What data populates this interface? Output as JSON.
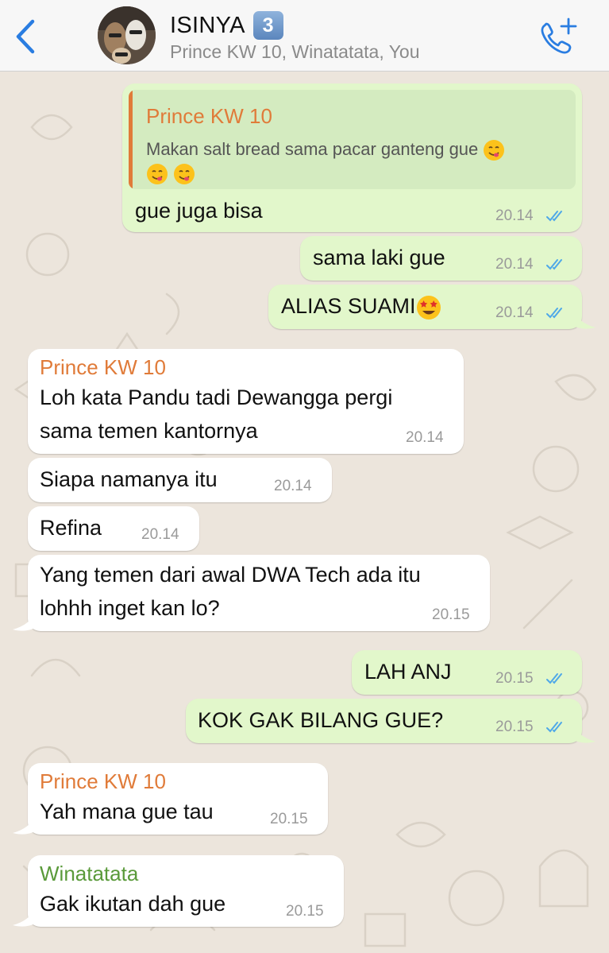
{
  "header": {
    "title": "ISINYA",
    "badge": "3",
    "subtitle": "Prince KW 10, Winatatata, You"
  },
  "colors": {
    "incoming": "#ffffff",
    "outgoing": "#e2f7cb",
    "sender_prince": "#e07b39",
    "sender_winatatata": "#5a9a3a",
    "ticks": "#4fa8e8",
    "accent": "#2a7de1"
  },
  "messages": [
    {
      "side": "out",
      "reply": {
        "sender": "Prince KW 10",
        "text": "Makan salt bread sama pacar ganteng gue",
        "emojis": [
          "yum",
          "yum",
          "yum"
        ]
      },
      "text": "gue juga bisa",
      "time": "20.14",
      "read": true
    },
    {
      "side": "out",
      "text": "sama laki gue",
      "time": "20.14",
      "read": true
    },
    {
      "side": "out",
      "text": "ALIAS SUAMI",
      "emoji": "star-struck",
      "time": "20.14",
      "read": true
    },
    {
      "side": "in",
      "sender": "Prince KW 10",
      "lines": [
        "Loh kata Pandu tadi Dewangga pergi",
        "sama temen kantornya"
      ],
      "time": "20.14"
    },
    {
      "side": "in",
      "text": "Siapa namanya itu",
      "time": "20.14"
    },
    {
      "side": "in",
      "text": "Refina",
      "time": "20.14"
    },
    {
      "side": "in",
      "lines": [
        "Yang temen dari awal DWA Tech ada itu",
        "lohhh inget kan lo?"
      ],
      "time": "20.15"
    },
    {
      "side": "out",
      "text": "LAH ANJ",
      "time": "20.15",
      "read": true
    },
    {
      "side": "out",
      "text": "KOK GAK BILANG GUE?",
      "time": "20.15",
      "read": true
    },
    {
      "side": "in",
      "sender": "Prince KW 10",
      "text": "Yah mana gue tau",
      "time": "20.15"
    },
    {
      "side": "in",
      "sender": "Winatatata",
      "text": "Gak ikutan dah gue",
      "time": "20.15"
    }
  ]
}
